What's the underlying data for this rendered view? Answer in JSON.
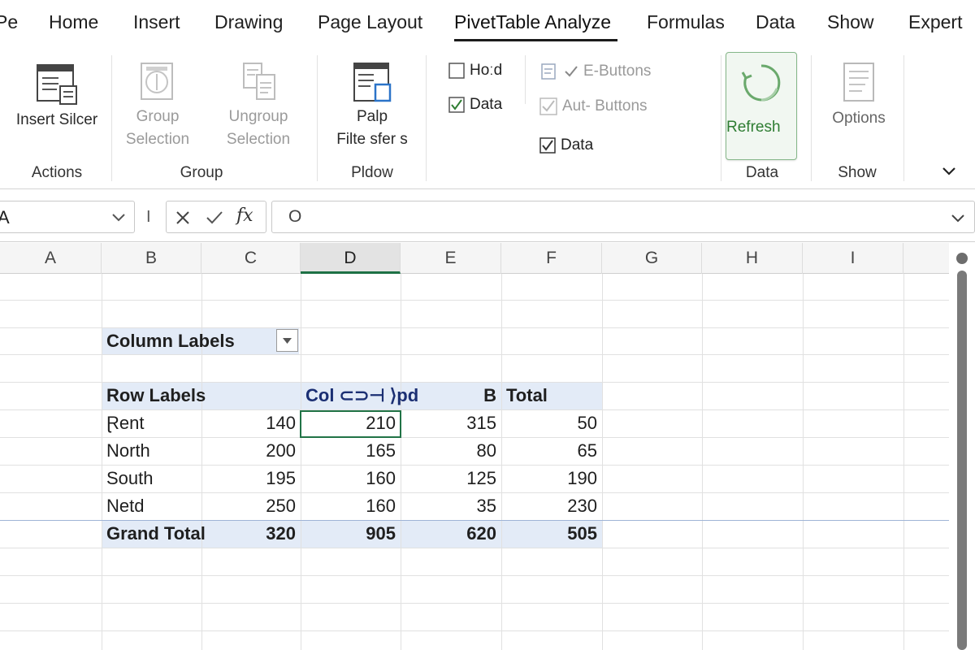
{
  "tabs": [
    "Pe",
    "Home",
    "Insert",
    "Drawing",
    "Page Layout",
    "PivetTable Analyze",
    "Formulas",
    "Data",
    "Show",
    "Expert"
  ],
  "active_tab": "PivetTable Analyze",
  "ribbon": {
    "insert_slicer": "Insert Silcer",
    "actions_group": "Actions",
    "group_selection": [
      "Group",
      "Selection"
    ],
    "ungroup_selection": [
      "Ungroup",
      "Selection"
    ],
    "group_group": "Group",
    "palp_filter": [
      "Palp",
      "Filte sfer s"
    ],
    "pldow_group": "Pldow",
    "checkboxes": {
      "hold": "Hoːd",
      "data1": "Data",
      "e_buttons": "E-Buttons",
      "aut_buttons": "Aut- Buttons",
      "data2": "Data"
    },
    "refresh": "Refresh",
    "data_group": "Data",
    "options": "Options",
    "show_group": "Show",
    "accent_color": "#2e7d32"
  },
  "formula_bar": {
    "name_box": "A",
    "divider": "I",
    "fx": "fx",
    "content": "O"
  },
  "columns": [
    "A",
    "B",
    "C",
    "D",
    "E",
    "F",
    "G",
    "H",
    "I"
  ],
  "selected_column": "D",
  "pivot": {
    "column_labels": "Column Labels",
    "header": {
      "row_labels": "Row Labels",
      "col_header": "Col ⊂⊃⊣ ⟩pd",
      "b": "B",
      "total": "Total"
    },
    "rows": [
      {
        "label": "Ɽent",
        "c": "140",
        "d": "210",
        "e": "315",
        "f": "50"
      },
      {
        "label": "North",
        "c": "200",
        "d": "165",
        "e": "80",
        "f": "65"
      },
      {
        "label": "South",
        "c": "195",
        "d": "160",
        "e": "125",
        "f": "190"
      },
      {
        "label": "Netd",
        "c": "250",
        "d": "160",
        "e": "35",
        "f": "230"
      }
    ],
    "grand_total": {
      "label": "Grand Total",
      "c": "320",
      "d": "905",
      "e": "620",
      "f": "505"
    },
    "band_color": "#e3ebf7",
    "header_text_color": "#1b2f73"
  }
}
